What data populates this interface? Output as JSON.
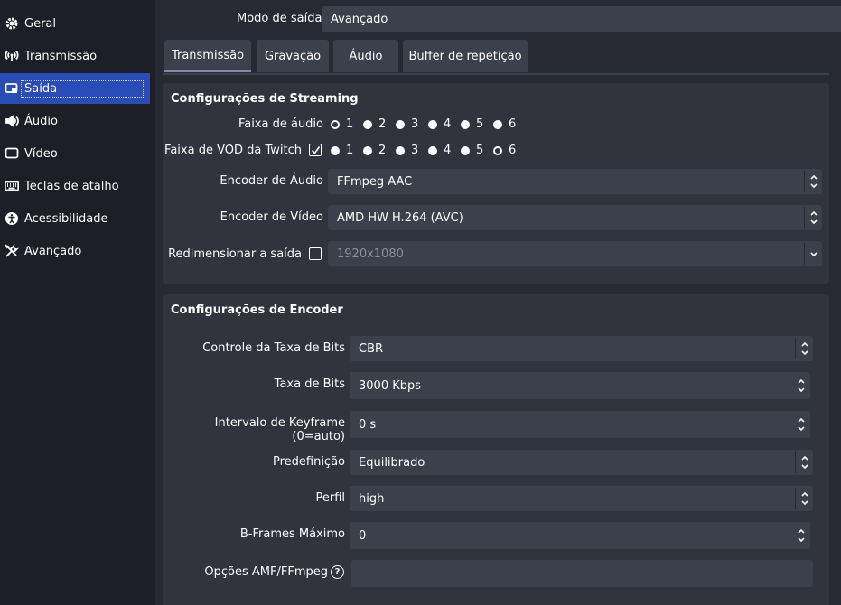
{
  "sidebar": {
    "items": [
      {
        "label": "Geral",
        "icon": "gear-icon"
      },
      {
        "label": "Transmissão",
        "icon": "broadcast-icon"
      },
      {
        "label": "Saída",
        "icon": "output-icon",
        "active": true
      },
      {
        "label": "Áudio",
        "icon": "speaker-icon"
      },
      {
        "label": "Vídeo",
        "icon": "monitor-icon"
      },
      {
        "label": "Teclas de atalho",
        "icon": "keyboard-icon"
      },
      {
        "label": "Acessibilidade",
        "icon": "accessibility-icon"
      },
      {
        "label": "Avançado",
        "icon": "tools-icon"
      }
    ]
  },
  "output_mode": {
    "label": "Modo de saída",
    "value": "Avançado"
  },
  "tabs": [
    "Transmissão",
    "Gravação",
    "Áudio",
    "Buffer de repetição"
  ],
  "streaming": {
    "title": "Configurações de Streaming",
    "audio_track_label": "Faixa de áudio",
    "track_numbers": [
      "1",
      "2",
      "3",
      "4",
      "5",
      "6"
    ],
    "audio_track_selected": "1",
    "vod_label": "Faixa de VOD da Twitch",
    "vod_checked": true,
    "vod_track_selected": "6",
    "audio_encoder_label": "Encoder de Áudio",
    "audio_encoder_value": "FFmpeg AAC",
    "video_encoder_label": "Encoder de Vídeo",
    "video_encoder_value": "AMD HW H.264 (AVC)",
    "rescale_label": "Redimensionar a saída",
    "rescale_checked": false,
    "rescale_value": "1920x1080"
  },
  "encoder": {
    "title": "Configurações de Encoder",
    "rate_control_label": "Controle da Taxa de Bits",
    "rate_control_value": "CBR",
    "bitrate_label": "Taxa de Bits",
    "bitrate_value": "3000 Kbps",
    "keyframe_label": "Intervalo de Keyframe (0=auto)",
    "keyframe_value": "0 s",
    "preset_label": "Predefinição",
    "preset_value": "Equilibrado",
    "profile_label": "Perfil",
    "profile_value": "high",
    "bframes_label": "B-Frames Máximo",
    "bframes_value": "0",
    "options_label": "Opções AMF/FFmpeg",
    "help_glyph": "?"
  },
  "colors": {
    "background": "#1d1f26",
    "panel": "#272a33",
    "group": "#31343d",
    "field": "#3c404b",
    "accent": "#284cb8"
  }
}
